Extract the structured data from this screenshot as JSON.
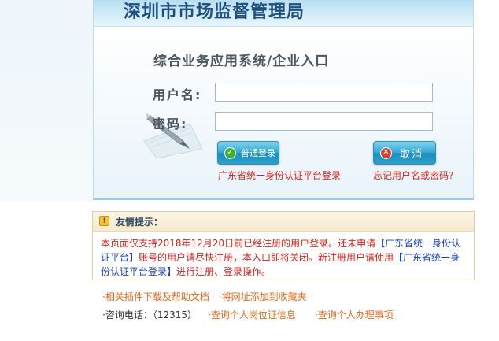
{
  "header": {
    "bureau_title": "深圳市市场监督管理局"
  },
  "login": {
    "system_title": "综合业务应用系统/企业入口",
    "username_label": "用户名:",
    "password_label": "密码:",
    "username_value": "",
    "password_value": "",
    "normal_login_button": "普通登录",
    "cancel_button": "取消",
    "gd_unified_login_link": "广东省统一身份认证平台登录",
    "forgot_link": "忘记用户名或密码?"
  },
  "tips": {
    "title": "友情提示：",
    "text_part1": "本页面仅支持2018年12月20日前已经注册的用户登录。还未申请",
    "link_1": "【广东省统一身份认证平台】",
    "text_part2": "账号的用户请尽快注册，本入口即将关闭。新注册用户请使用",
    "link_2": "【广东省统一身份认证平台登录】",
    "text_part3": "进行注册、登录操作。"
  },
  "footer": {
    "dot": "·",
    "plugin_help_link": "相关插件下载及帮助文档",
    "bookmark_link": "将网址添加到收藏夹",
    "consult_phone": "咨询电话：（12315）",
    "personal_cert_link": "查询个人岗位证信息",
    "personal_affairs_link": "查询个人办理事项"
  },
  "colors": {
    "title_blue": "#1f4f7d",
    "link_red": "#d2231c",
    "link_blue": "#1a3fb3",
    "footer_orange": "#e06a1c",
    "button_blue": "#2aa0cc"
  }
}
